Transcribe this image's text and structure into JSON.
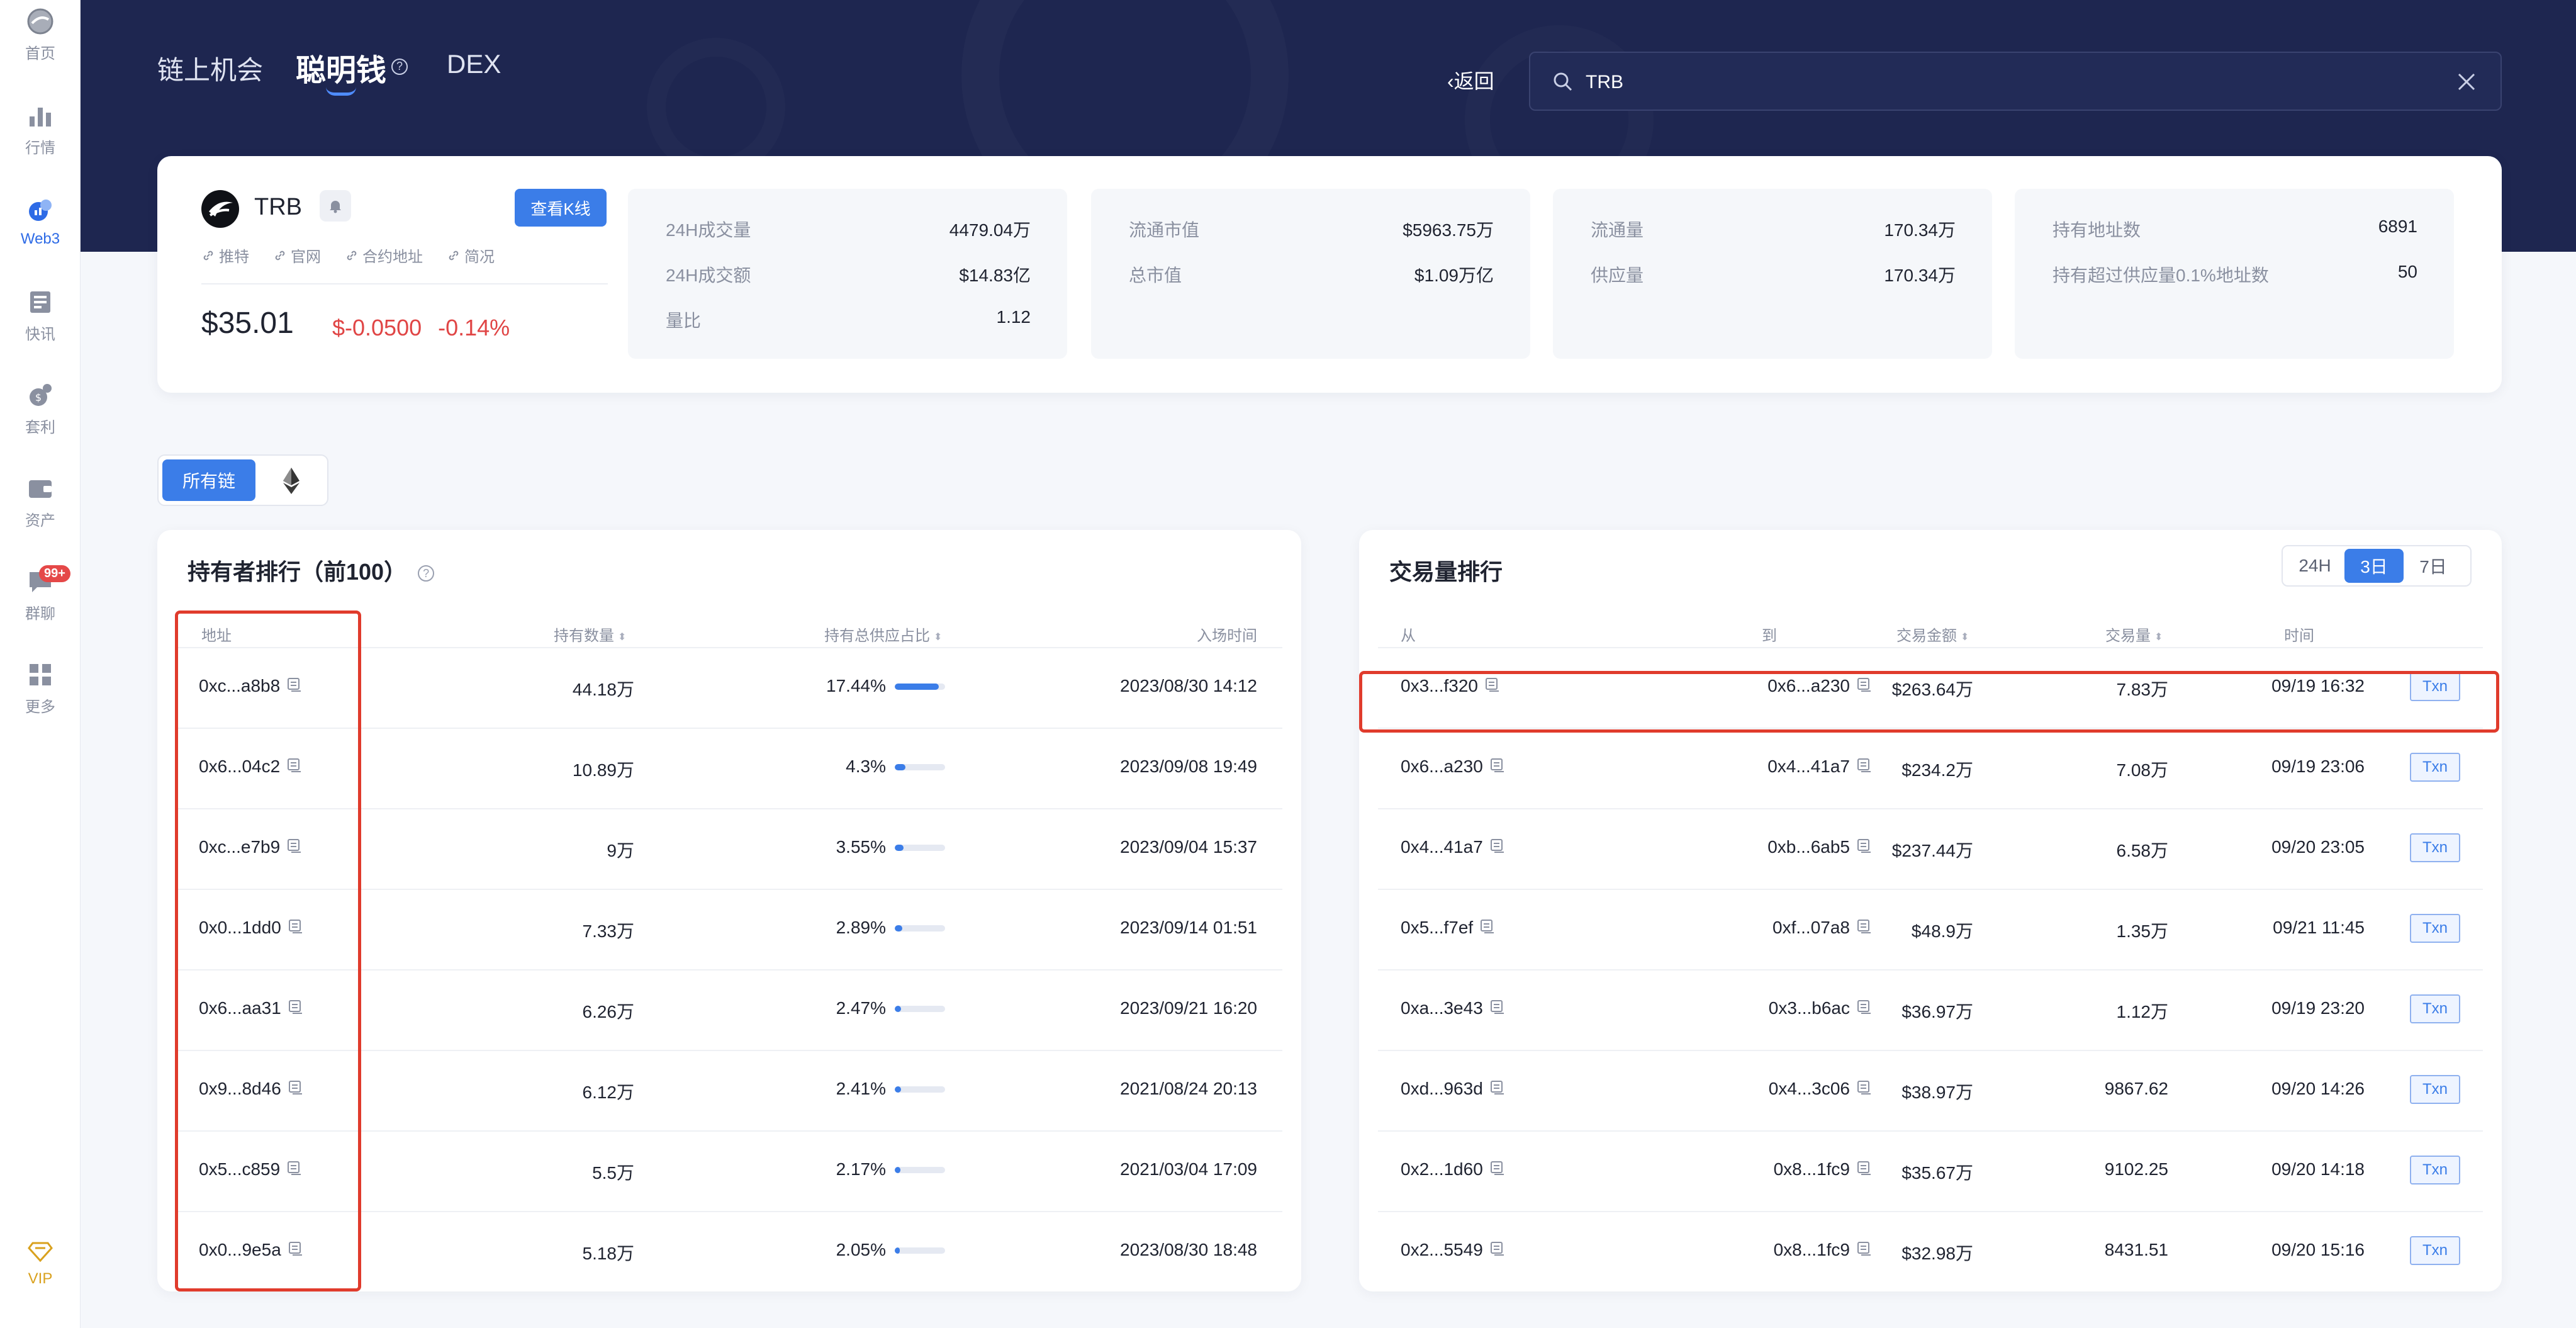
{
  "sidebar": {
    "items": [
      {
        "label": "首页",
        "icon": "home-icon"
      },
      {
        "label": "行情",
        "icon": "market-chart-icon"
      },
      {
        "label": "Web3",
        "icon": "web3-icon",
        "active": true
      },
      {
        "label": "快讯",
        "icon": "news-icon"
      },
      {
        "label": "套利",
        "icon": "arbitrage-icon"
      },
      {
        "label": "资产",
        "icon": "wallet-icon"
      },
      {
        "label": "群聊",
        "icon": "chat-icon",
        "badge": "99+"
      },
      {
        "label": "更多",
        "icon": "more-grid-icon"
      }
    ],
    "vip": "VIP"
  },
  "header": {
    "tabs": [
      "链上机会",
      "聪明钱",
      "DEX"
    ],
    "active_tab": "聪明钱",
    "back": "返回",
    "search": {
      "value": "TRB",
      "placeholder": ""
    }
  },
  "coin": {
    "name": "TRB",
    "kline_button": "查看K线",
    "links": [
      "推特",
      "官网",
      "合约地址",
      "简况"
    ],
    "price": "$35.01",
    "change_abs": "$-0.0500",
    "change_pct": "-0.14%"
  },
  "stats": [
    [
      {
        "label": "24H成交量",
        "value": "4479.04万"
      },
      {
        "label": "24H成交额",
        "value": "$14.83亿"
      },
      {
        "label": "量比",
        "value": "1.12"
      }
    ],
    [
      {
        "label": "流通市值",
        "value": "$5963.75万"
      },
      {
        "label": "总市值",
        "value": "$1.09万亿"
      }
    ],
    [
      {
        "label": "流通量",
        "value": "170.34万"
      },
      {
        "label": "供应量",
        "value": "170.34万"
      }
    ],
    [
      {
        "label": "持有地址数",
        "value": "6891"
      },
      {
        "label": "持有超过供应量0.1%地址数",
        "value": "50"
      }
    ]
  ],
  "chain_selector": {
    "all": "所有链",
    "eth_icon": "ethereum-icon"
  },
  "holders": {
    "title": "持有者排行（前100）",
    "columns": [
      "地址",
      "持有数量",
      "持有总供应占比",
      "入场时间"
    ],
    "rows": [
      {
        "address": "0xc...a8b8",
        "amount": "44.18万",
        "pct": "17.44%",
        "share": 0.1744,
        "time": "2023/08/30 14:12"
      },
      {
        "address": "0x6...04c2",
        "amount": "10.89万",
        "pct": "4.3%",
        "share": 0.043,
        "time": "2023/09/08 19:49"
      },
      {
        "address": "0xc...e7b9",
        "amount": "9万",
        "pct": "3.55%",
        "share": 0.0355,
        "time": "2023/09/04 15:37"
      },
      {
        "address": "0x0...1dd0",
        "amount": "7.33万",
        "pct": "2.89%",
        "share": 0.0289,
        "time": "2023/09/14 01:51"
      },
      {
        "address": "0x6...aa31",
        "amount": "6.26万",
        "pct": "2.47%",
        "share": 0.0247,
        "time": "2023/09/21 16:20"
      },
      {
        "address": "0x9...8d46",
        "amount": "6.12万",
        "pct": "2.41%",
        "share": 0.0241,
        "time": "2021/08/24 20:13"
      },
      {
        "address": "0x5...c859",
        "amount": "5.5万",
        "pct": "2.17%",
        "share": 0.0217,
        "time": "2021/03/04 17:09"
      },
      {
        "address": "0x0...9e5a",
        "amount": "5.18万",
        "pct": "2.05%",
        "share": 0.0205,
        "time": "2023/08/30 18:48"
      }
    ]
  },
  "volume": {
    "title": "交易量排行",
    "periods": [
      "24H",
      "3日",
      "7日"
    ],
    "active_period": "3日",
    "columns": [
      "从",
      "到",
      "交易金额",
      "交易量",
      "时间"
    ],
    "txn_label": "Txn",
    "rows": [
      {
        "from": "0x3...f320",
        "to": "0x6...a230",
        "value": "$263.64万",
        "qty": "7.83万",
        "time": "09/19 16:32"
      },
      {
        "from": "0x6...a230",
        "to": "0x4...41a7",
        "value": "$234.2万",
        "qty": "7.08万",
        "time": "09/19 23:06"
      },
      {
        "from": "0x4...41a7",
        "to": "0xb...6ab5",
        "value": "$237.44万",
        "qty": "6.58万",
        "time": "09/20 23:05"
      },
      {
        "from": "0x5...f7ef",
        "to": "0xf...07a8",
        "value": "$48.9万",
        "qty": "1.35万",
        "time": "09/21 11:45"
      },
      {
        "from": "0xa...3e43",
        "to": "0x3...b6ac",
        "value": "$36.97万",
        "qty": "1.12万",
        "time": "09/19 23:20"
      },
      {
        "from": "0xd...963d",
        "to": "0x4...3c06",
        "value": "$38.97万",
        "qty": "9867.62",
        "time": "09/20 14:26"
      },
      {
        "from": "0x2...1d60",
        "to": "0x8...1fc9",
        "value": "$35.67万",
        "qty": "9102.25",
        "time": "09/20 14:18"
      },
      {
        "from": "0x2...5549",
        "to": "0x8...1fc9",
        "value": "$32.98万",
        "qty": "8431.51",
        "time": "09/20 15:16"
      }
    ]
  },
  "colors": {
    "accent": "#3b7de8",
    "header_bg": "#1e2650",
    "negative": "#e04545",
    "highlight": "#e03b2c"
  }
}
